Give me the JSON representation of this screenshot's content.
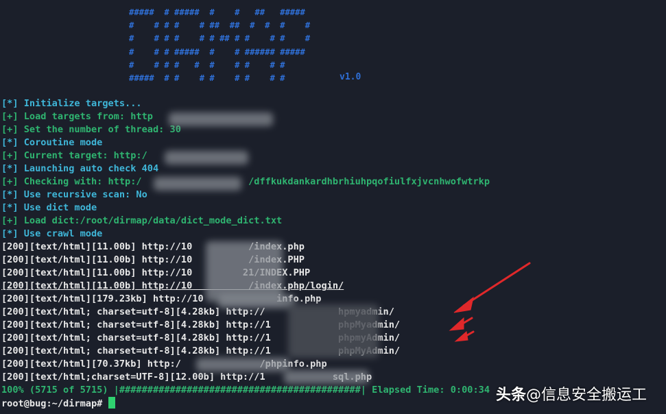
{
  "banner": {
    "ascii": "#####  # #####  #    #   ##   #####\n#    # # #    # ##  ##  #  #  #    #\n#    # # #    # # ## # #    # #    #\n#    # # #####  #    # ###### #####\n#    # # #   #  #    # #    # #\n#####  # #    # #    # #    # #",
    "version": "v1.0"
  },
  "log_lines": [
    {
      "text": "[*] Initialize targets...",
      "color": "cyan"
    },
    {
      "text": "[+] Load targets from: http",
      "color": "green"
    },
    {
      "text": "[+] Set the number of thread: 30",
      "color": "green"
    },
    {
      "text": "[*] Coroutine mode",
      "color": "cyan"
    },
    {
      "text": "[+] Current target: http:/",
      "color": "green"
    },
    {
      "text": "[*] Launching auto check 404",
      "color": "cyan"
    },
    {
      "text": "[+] Checking with: http:/                   /dffkukdankardhbrhiuhpqofiulfxjvcnhwofwtrkp",
      "color": "green"
    },
    {
      "text": "[*] Use recursive scan: No",
      "color": "cyan"
    },
    {
      "text": "[*] Use dict mode",
      "color": "cyan"
    },
    {
      "text": "[+] Load dict:/root/dirmap/data/dict_mode_dict.txt",
      "color": "green"
    },
    {
      "text": "[*] Use crawl mode",
      "color": "cyan"
    },
    {
      "text": "[200][text/html][11.00b] http://10          /index.php",
      "color": "white"
    },
    {
      "text": "[200][text/html][11.00b] http://10          /index.PHP",
      "color": "white"
    },
    {
      "text": "[200][text/html][11.00b] http://10         21/INDEX.PHP",
      "color": "white"
    },
    {
      "text": "[200][text/html][11.00b] http://10          /index.php/login/",
      "color": "white"
    },
    {
      "text": "[200][text/html][179.23kb] http://10             info.php",
      "color": "white"
    },
    {
      "text": "[200][text/html; charset=utf-8][4.28kb] http://             hpmyadmin/",
      "color": "white"
    },
    {
      "text": "[200][text/html; charset=utf-8][4.28kb] http://1            phpMyadmin/",
      "color": "white"
    },
    {
      "text": "[200][text/html; charset=utf-8][4.28kb] http://1            phpmyAdmin/",
      "color": "white"
    },
    {
      "text": "[200][text/html; charset=utf-8][4.28kb] http://1            phpMyAdmin/",
      "color": "white"
    },
    {
      "text": "[200][text/html][70.37kb] http:/              /phpinfo.php",
      "color": "white"
    },
    {
      "text": "[200][text/html;charset=UTF-8][12.00b] http://1            sql.php",
      "color": "white"
    },
    {
      "text": "100% (5715 of 5715) |###########################################| Elapsed Time: 0:00:34",
      "color": "green"
    }
  ],
  "prompt": "root@bug:~/dirmap# ",
  "watermark": {
    "brand": "头条",
    "account": "@信息安全搬运工"
  },
  "colors": {
    "background": "#1b1f2a",
    "cyan": "#3fb6d8",
    "green": "#2fb470",
    "white": "#e8e8e8",
    "banner": "#2f6fd6",
    "arrow": "#e0282a",
    "cursor": "#2fd16f"
  }
}
